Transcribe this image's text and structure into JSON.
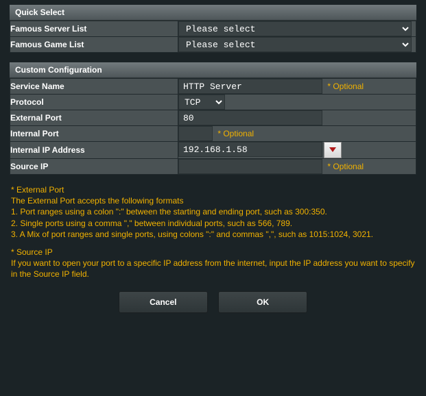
{
  "quick_select": {
    "title": "Quick Select",
    "server_list_label": "Famous Server List",
    "server_list_value": "Please select",
    "game_list_label": "Famous Game List",
    "game_list_value": "Please select"
  },
  "custom": {
    "title": "Custom Configuration",
    "service_name_label": "Service Name",
    "service_name_value": "HTTP Server",
    "optional_label": "* Optional",
    "protocol_label": "Protocol",
    "protocol_value": "TCP",
    "external_port_label": "External Port",
    "external_port_value": "80",
    "internal_port_label": "Internal Port",
    "internal_port_value": "",
    "internal_ip_label": "Internal IP Address",
    "internal_ip_value": "192.168.1.58",
    "source_ip_label": "Source IP",
    "source_ip_value": ""
  },
  "help": {
    "ext_title": "* External Port",
    "ext_l1": "The External Port accepts the following formats",
    "ext_l2": "1. Port ranges using a colon \":\" between the starting and ending port, such as 300:350.",
    "ext_l3": "2. Single ports using a comma \",\" between individual ports, such as 566, 789.",
    "ext_l4": "3. A Mix of port ranges and single ports, using colons \":\" and commas \",\", such as 1015:1024, 3021.",
    "src_title": "* Source IP",
    "src_l1": "If you want to open your port to a specific IP address from the internet, input the IP address you want to specify in the Source IP field."
  },
  "buttons": {
    "cancel": "Cancel",
    "ok": "OK"
  }
}
